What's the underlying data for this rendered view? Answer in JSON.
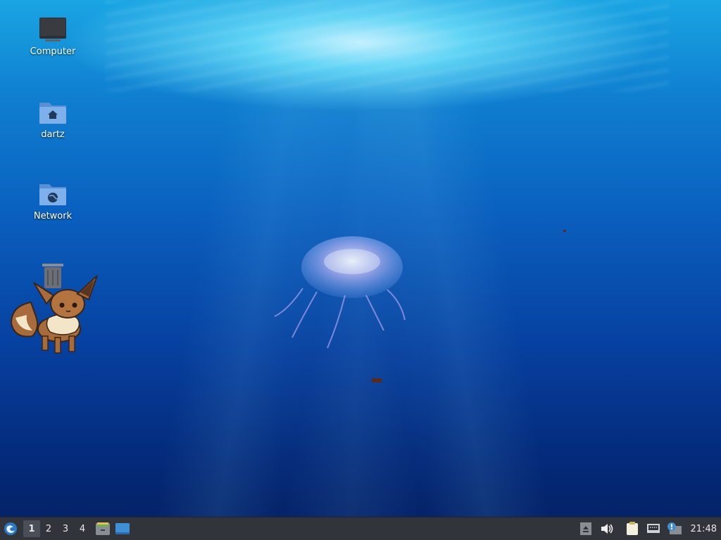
{
  "desktop": {
    "icons": [
      {
        "label": "Computer",
        "icon": "computer-icon"
      },
      {
        "label": "dartz",
        "icon": "home-folder-icon"
      },
      {
        "label": "Network",
        "icon": "network-folder-icon"
      },
      {
        "label": "",
        "icon": "trash-icon"
      }
    ],
    "wallpaper": "underwater-jellyfish",
    "mascot": "eevee-sprite"
  },
  "taskbar": {
    "start_icon": "lxqt-menu-icon",
    "workspaces": [
      "1",
      "2",
      "3",
      "4"
    ],
    "active_workspace": "1",
    "launchers": [
      "file-manager-icon",
      "show-desktop-icon"
    ],
    "tray": [
      "up-arrow-icon",
      "volume-icon",
      "clipboard-icon",
      "network-icon",
      "update-notifier-icon"
    ],
    "clock": "21:48"
  },
  "colors": {
    "taskbar_bg": "#31343a",
    "accent": "#3d8fd6"
  }
}
